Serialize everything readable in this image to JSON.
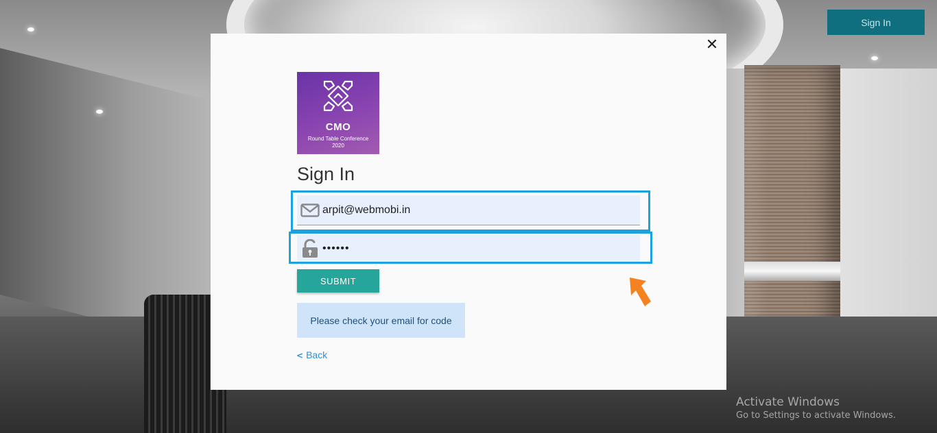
{
  "header": {
    "signin_label": "Sign In"
  },
  "modal": {
    "close_icon": "close-icon",
    "logo": {
      "brand": "CMO",
      "subtitle_line1": "Round Table Conference",
      "subtitle_line2": "2020"
    },
    "title": "Sign In",
    "email": {
      "value": "arpit@webmobi.in",
      "icon": "envelope-icon"
    },
    "password": {
      "value": "••••••",
      "icon": "unlock-icon"
    },
    "submit_label": "SUBMIT",
    "notice": "Please check your email for code",
    "back_label": "Back"
  },
  "watermark": {
    "line1": "Activate Windows",
    "line2": "Go to Settings to activate Windows."
  },
  "colors": {
    "accent_teal": "#26a69a",
    "header_button": "#0f6f7e",
    "highlight_box": "#1aa3e0",
    "arrow": "#f58220",
    "notice_bg": "#cfe4f9"
  }
}
